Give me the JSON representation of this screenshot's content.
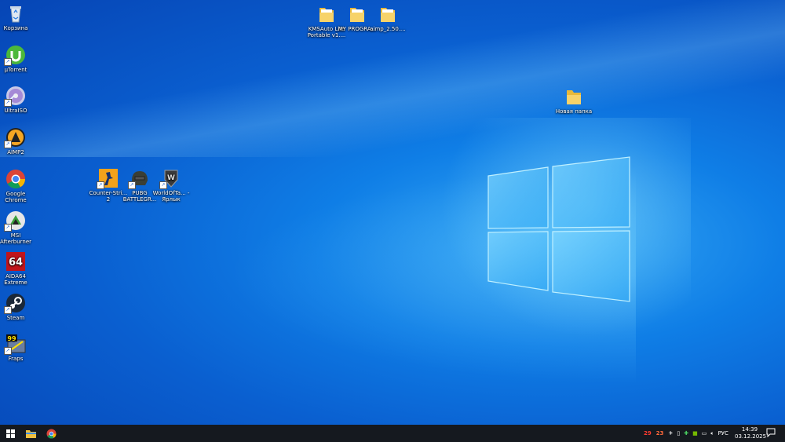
{
  "desktop": {
    "icons": [
      {
        "label": "Корзина",
        "icon": "recycle-bin-icon"
      },
      {
        "label": "µTorrent",
        "icon": "utorrent-icon"
      },
      {
        "label": "UltraISO",
        "icon": "ultraiso-icon"
      },
      {
        "label": "AIMP2",
        "icon": "aimp-icon"
      },
      {
        "label": "Google Chrome",
        "icon": "chrome-icon"
      },
      {
        "label": "MSI Afterburner",
        "icon": "msi-afterburner-icon"
      },
      {
        "label": "AIDA64 Extreme",
        "icon": "aida64-icon"
      },
      {
        "label": "Steam",
        "icon": "steam-icon"
      },
      {
        "label": "Fraps",
        "icon": "fraps-icon"
      },
      {
        "label": "Counter-Stri... 2",
        "icon": "counter-strike-icon"
      },
      {
        "label": "PUBG BATTLEGR...",
        "icon": "pubg-icon"
      },
      {
        "label": "WorldOfTa... - Ярлык",
        "icon": "world-of-tanks-icon"
      },
      {
        "label": "KMSAuto Lite Portable v1....",
        "icon": "folder-icon"
      },
      {
        "label": "MY PROGRA...",
        "icon": "folder-icon"
      },
      {
        "label": "aimp_2.50....",
        "icon": "folder-icon"
      },
      {
        "label": "Новая папка",
        "icon": "folder-icon"
      }
    ]
  },
  "taskbar": {
    "start": "windows-start-icon",
    "pinned": [
      "file-explorer-icon",
      "chrome-icon"
    ],
    "tray": {
      "temp1": "29",
      "temp2": "23",
      "language": "РУС",
      "time": "14:39",
      "date": "03.12.2025"
    }
  },
  "colors": {
    "accent": "#0a78e6",
    "taskbar": "#15191f",
    "temp_red": "#ff3b30"
  }
}
